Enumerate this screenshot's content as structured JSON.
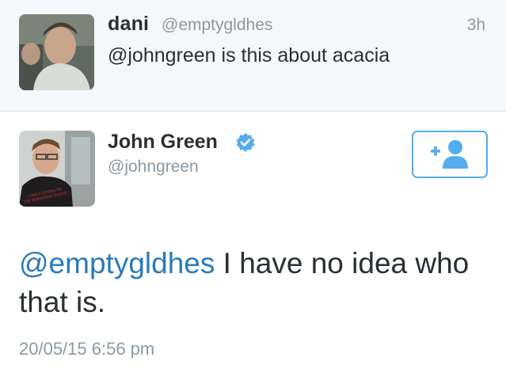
{
  "reply": {
    "name": "dani",
    "handle": "@emptygldhes",
    "time": "3h",
    "text": "@johngreen is this about acacia"
  },
  "main": {
    "name": "John Green",
    "handle": "@johngreen",
    "verified": true,
    "follow_icon": "add-user-icon",
    "avatar_shirt_text": "I ONLY LISTEN TO THE MOUNTAIN GOATS",
    "text_mention": "@emptygldhes",
    "text_body": " I have no idea who that is.",
    "timestamp": "20/05/15 6:56 pm"
  },
  "colors": {
    "link": "#2b7bb9",
    "accent": "#55acee",
    "muted": "#8899a6",
    "text": "#292f33"
  }
}
